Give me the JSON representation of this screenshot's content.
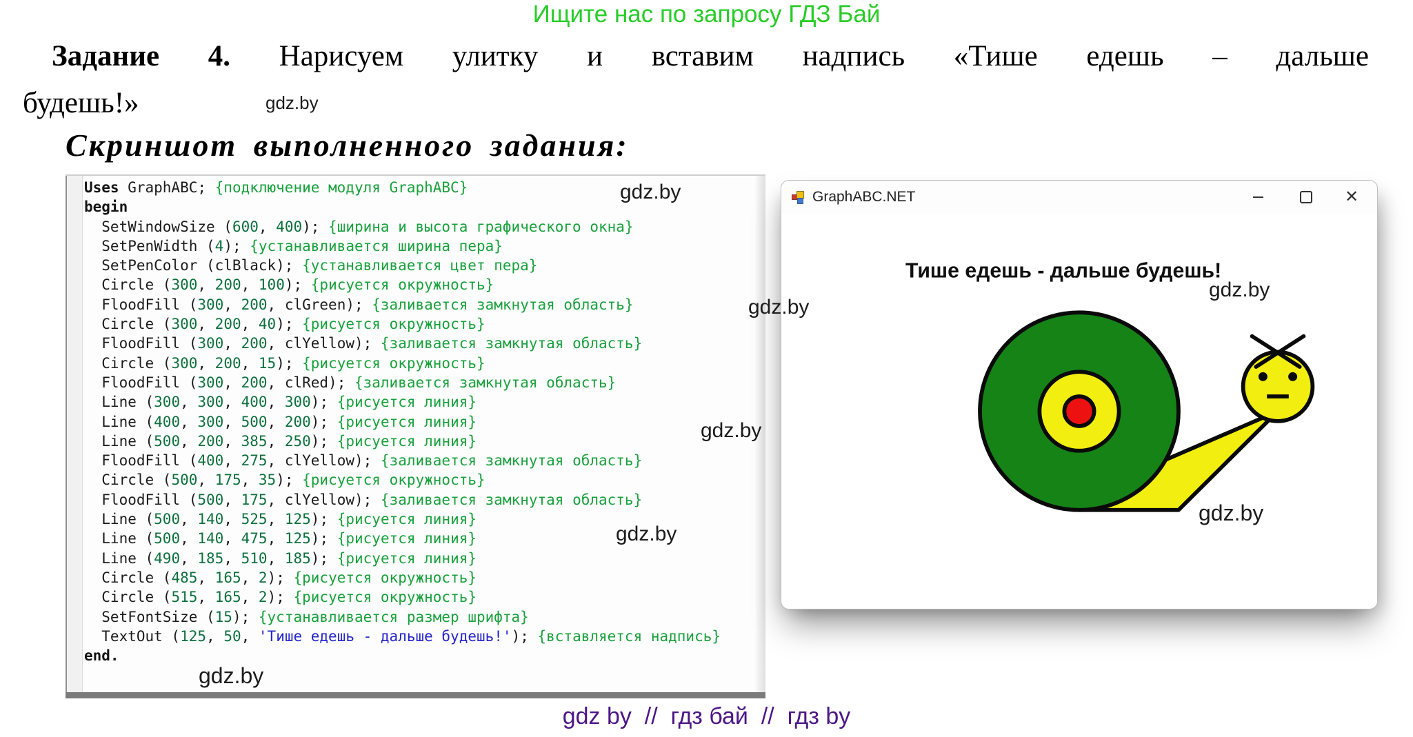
{
  "banner": {
    "text": "Ищите нас по запросу ГДЗ Бай"
  },
  "task": {
    "label": "Задание 4.",
    "line1_rest": "Нарисуем улитку и вставим надпись «Тише едешь – дальше",
    "line2": "будешь!»"
  },
  "subtitle": "Скриншот выполненного задания:",
  "watermark_label": "gdz.by",
  "code": {
    "lines": [
      [
        [
          "k",
          "Uses"
        ],
        [
          "p",
          " GraphABC; "
        ],
        [
          "c",
          "{подключение модуля GraphABC}"
        ]
      ],
      [
        [
          "k",
          "begin"
        ]
      ],
      [
        [
          "p",
          "  SetWindowSize ("
        ],
        [
          "n",
          "600"
        ],
        [
          "p",
          ", "
        ],
        [
          "n",
          "400"
        ],
        [
          "p",
          "); "
        ],
        [
          "c",
          "{ширина и высота графического окна}"
        ]
      ],
      [
        [
          "p",
          "  SetPenWidth ("
        ],
        [
          "n",
          "4"
        ],
        [
          "p",
          "); "
        ],
        [
          "c",
          "{устанавливается ширина пера}"
        ]
      ],
      [
        [
          "p",
          "  SetPenColor (clBlack); "
        ],
        [
          "c",
          "{устанавливается цвет пера}"
        ]
      ],
      [
        [
          "p",
          "  Circle ("
        ],
        [
          "n",
          "300"
        ],
        [
          "p",
          ", "
        ],
        [
          "n",
          "200"
        ],
        [
          "p",
          ", "
        ],
        [
          "n",
          "100"
        ],
        [
          "p",
          "); "
        ],
        [
          "c",
          "{рисуется окружность}"
        ]
      ],
      [
        [
          "p",
          "  FloodFill ("
        ],
        [
          "n",
          "300"
        ],
        [
          "p",
          ", "
        ],
        [
          "n",
          "200"
        ],
        [
          "p",
          ", clGreen); "
        ],
        [
          "c",
          "{заливается замкнутая область}"
        ]
      ],
      [
        [
          "p",
          "  Circle ("
        ],
        [
          "n",
          "300"
        ],
        [
          "p",
          ", "
        ],
        [
          "n",
          "200"
        ],
        [
          "p",
          ", "
        ],
        [
          "n",
          "40"
        ],
        [
          "p",
          "); "
        ],
        [
          "c",
          "{рисуется окружность}"
        ]
      ],
      [
        [
          "p",
          "  FloodFill ("
        ],
        [
          "n",
          "300"
        ],
        [
          "p",
          ", "
        ],
        [
          "n",
          "200"
        ],
        [
          "p",
          ", clYellow); "
        ],
        [
          "c",
          "{заливается замкнутая область}"
        ]
      ],
      [
        [
          "p",
          "  Circle ("
        ],
        [
          "n",
          "300"
        ],
        [
          "p",
          ", "
        ],
        [
          "n",
          "200"
        ],
        [
          "p",
          ", "
        ],
        [
          "n",
          "15"
        ],
        [
          "p",
          "); "
        ],
        [
          "c",
          "{рисуется окружность}"
        ]
      ],
      [
        [
          "p",
          "  FloodFill ("
        ],
        [
          "n",
          "300"
        ],
        [
          "p",
          ", "
        ],
        [
          "n",
          "200"
        ],
        [
          "p",
          ", clRed); "
        ],
        [
          "c",
          "{заливается замкнутая область}"
        ]
      ],
      [
        [
          "p",
          "  Line ("
        ],
        [
          "n",
          "300"
        ],
        [
          "p",
          ", "
        ],
        [
          "n",
          "300"
        ],
        [
          "p",
          ", "
        ],
        [
          "n",
          "400"
        ],
        [
          "p",
          ", "
        ],
        [
          "n",
          "300"
        ],
        [
          "p",
          "); "
        ],
        [
          "c",
          "{рисуется линия}"
        ]
      ],
      [
        [
          "p",
          "  Line ("
        ],
        [
          "n",
          "400"
        ],
        [
          "p",
          ", "
        ],
        [
          "n",
          "300"
        ],
        [
          "p",
          ", "
        ],
        [
          "n",
          "500"
        ],
        [
          "p",
          ", "
        ],
        [
          "n",
          "200"
        ],
        [
          "p",
          "); "
        ],
        [
          "c",
          "{рисуется линия}"
        ]
      ],
      [
        [
          "p",
          "  Line ("
        ],
        [
          "n",
          "500"
        ],
        [
          "p",
          ", "
        ],
        [
          "n",
          "200"
        ],
        [
          "p",
          ", "
        ],
        [
          "n",
          "385"
        ],
        [
          "p",
          ", "
        ],
        [
          "n",
          "250"
        ],
        [
          "p",
          "); "
        ],
        [
          "c",
          "{рисуется линия}"
        ]
      ],
      [
        [
          "p",
          "  FloodFill ("
        ],
        [
          "n",
          "400"
        ],
        [
          "p",
          ", "
        ],
        [
          "n",
          "275"
        ],
        [
          "p",
          ", clYellow); "
        ],
        [
          "c",
          "{заливается замкнутая область}"
        ]
      ],
      [
        [
          "p",
          "  Circle ("
        ],
        [
          "n",
          "500"
        ],
        [
          "p",
          ", "
        ],
        [
          "n",
          "175"
        ],
        [
          "p",
          ", "
        ],
        [
          "n",
          "35"
        ],
        [
          "p",
          "); "
        ],
        [
          "c",
          "{рисуется окружность}"
        ]
      ],
      [
        [
          "p",
          "  FloodFill ("
        ],
        [
          "n",
          "500"
        ],
        [
          "p",
          ", "
        ],
        [
          "n",
          "175"
        ],
        [
          "p",
          ", clYellow); "
        ],
        [
          "c",
          "{заливается замкнутая область}"
        ]
      ],
      [
        [
          "p",
          "  Line ("
        ],
        [
          "n",
          "500"
        ],
        [
          "p",
          ", "
        ],
        [
          "n",
          "140"
        ],
        [
          "p",
          ", "
        ],
        [
          "n",
          "525"
        ],
        [
          "p",
          ", "
        ],
        [
          "n",
          "125"
        ],
        [
          "p",
          "); "
        ],
        [
          "c",
          "{рисуется линия}"
        ]
      ],
      [
        [
          "p",
          "  Line ("
        ],
        [
          "n",
          "500"
        ],
        [
          "p",
          ", "
        ],
        [
          "n",
          "140"
        ],
        [
          "p",
          ", "
        ],
        [
          "n",
          "475"
        ],
        [
          "p",
          ", "
        ],
        [
          "n",
          "125"
        ],
        [
          "p",
          "); "
        ],
        [
          "c",
          "{рисуется линия}"
        ]
      ],
      [
        [
          "p",
          "  Line ("
        ],
        [
          "n",
          "490"
        ],
        [
          "p",
          ", "
        ],
        [
          "n",
          "185"
        ],
        [
          "p",
          ", "
        ],
        [
          "n",
          "510"
        ],
        [
          "p",
          ", "
        ],
        [
          "n",
          "185"
        ],
        [
          "p",
          "); "
        ],
        [
          "c",
          "{рисуется линия}"
        ]
      ],
      [
        [
          "p",
          "  Circle ("
        ],
        [
          "n",
          "485"
        ],
        [
          "p",
          ", "
        ],
        [
          "n",
          "165"
        ],
        [
          "p",
          ", "
        ],
        [
          "n",
          "2"
        ],
        [
          "p",
          "); "
        ],
        [
          "c",
          "{рисуется окружность}"
        ]
      ],
      [
        [
          "p",
          "  Circle ("
        ],
        [
          "n",
          "515"
        ],
        [
          "p",
          ", "
        ],
        [
          "n",
          "165"
        ],
        [
          "p",
          ", "
        ],
        [
          "n",
          "2"
        ],
        [
          "p",
          "); "
        ],
        [
          "c",
          "{рисуется окружность}"
        ]
      ],
      [
        [
          "p",
          "  SetFontSize ("
        ],
        [
          "n",
          "15"
        ],
        [
          "p",
          "); "
        ],
        [
          "c",
          "{устанавливается размер шрифта}"
        ]
      ],
      [
        [
          "p",
          "  TextOut ("
        ],
        [
          "n",
          "125"
        ],
        [
          "p",
          ", "
        ],
        [
          "n",
          "50"
        ],
        [
          "p",
          ", "
        ],
        [
          "s",
          "'Тише едешь - дальше будешь!'"
        ],
        [
          "p",
          "); "
        ],
        [
          "c",
          "{вставляется надпись}"
        ]
      ],
      [
        [
          "k",
          "end."
        ]
      ]
    ]
  },
  "window": {
    "title": "GraphABC.NET",
    "caption": "Тише едешь - дальше будешь!",
    "controls": {
      "minimize": "minimize",
      "maximize": "maximize",
      "close": "close",
      "close_glyph": "✕"
    }
  },
  "footer": {
    "text": "gdz by  //  гдз бай  //  гдз by"
  },
  "colors": {
    "banner_green": "#27cc27",
    "comment_green": "#18a13c",
    "number_green": "#0c703c",
    "string_blue": "#2525cb",
    "footer_purple": "#4c1687",
    "shell_green": "#168316",
    "snail_yellow": "#f2ee0f",
    "core_red": "#ee1111",
    "outline_black": "#0a0a0a"
  }
}
